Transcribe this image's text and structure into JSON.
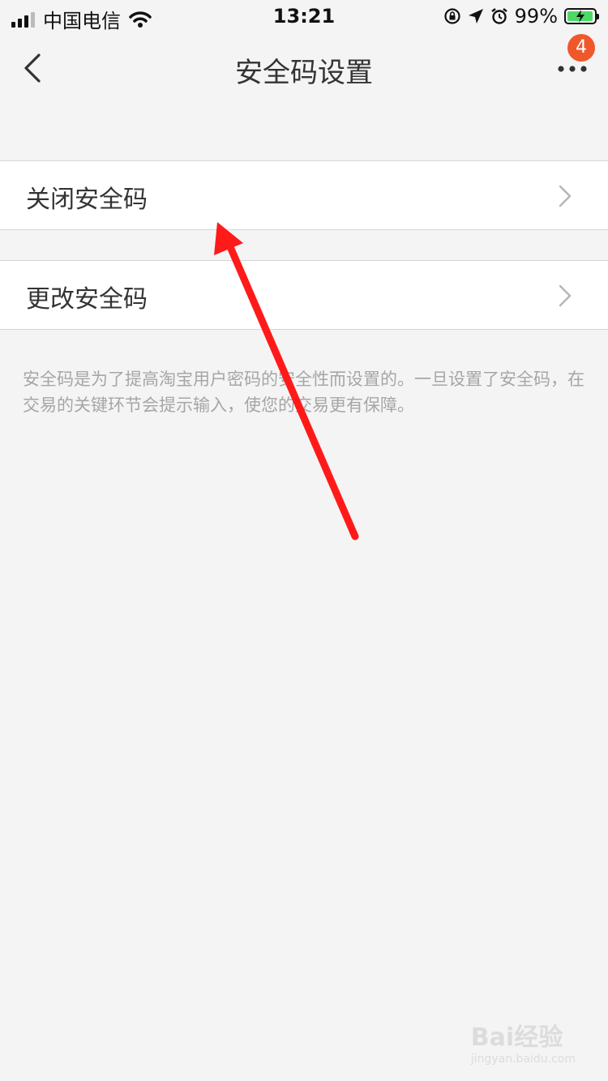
{
  "status_bar": {
    "carrier": "中国电信",
    "time": "13:21",
    "battery": "99%",
    "battery_level": 0.99
  },
  "nav": {
    "title": "安全码设置",
    "badge_count": "4"
  },
  "menu": [
    {
      "label": "关闭安全码"
    },
    {
      "label": "更改安全码"
    }
  ],
  "footer_note": "安全码是为了提高淘宝用户密码的安全性而设置的。一旦设置了安全码，在交易的关键环节会提示输入，使您的交易更有保障。",
  "annotation": {
    "arrow_color": "#ff1a1a"
  },
  "watermark": {
    "brand": "Bai经验",
    "domain": "jingyan.baidu.com"
  },
  "colors": {
    "background": "#f4f4f4",
    "badge": "#f0572a",
    "battery_fill": "#4cd964"
  }
}
